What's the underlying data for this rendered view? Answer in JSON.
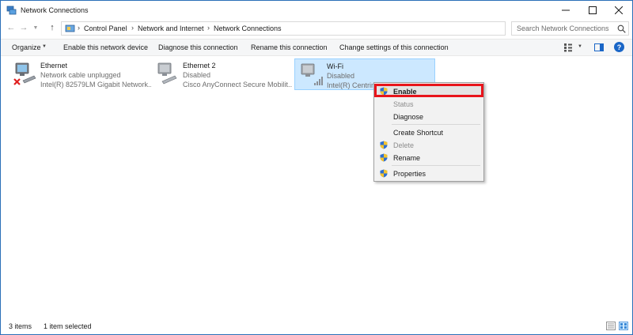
{
  "window": {
    "title": "Network Connections",
    "accent": "#2b6fb8"
  },
  "address": {
    "crumbs": [
      "Control Panel",
      "Network and Internet",
      "Network Connections"
    ]
  },
  "search": {
    "placeholder": "Search Network Connections"
  },
  "commands": {
    "organize": "Organize",
    "enable": "Enable this network device",
    "diagnose": "Diagnose this connection",
    "rename": "Rename this connection",
    "change": "Change settings of this connection"
  },
  "connections": [
    {
      "name": "Ethernet",
      "status": "Network cable unplugged",
      "device": "Intel(R) 82579LM Gigabit Network...",
      "icon": "ethernet-error-icon"
    },
    {
      "name": "Ethernet 2",
      "status": "Disabled",
      "device": "Cisco AnyConnect Secure Mobilit...",
      "icon": "ethernet-disabled-icon"
    },
    {
      "name": "Wi-Fi",
      "status": "Disabled",
      "device": "Intel(R) Centrino(R) Advanced-N...",
      "icon": "wifi-disabled-icon"
    }
  ],
  "context_menu": {
    "items": [
      {
        "label": "Enable",
        "shield": true,
        "bold": true,
        "disabled": false
      },
      {
        "label": "Status",
        "shield": false,
        "bold": false,
        "disabled": true
      },
      {
        "label": "Diagnose",
        "shield": false,
        "bold": false,
        "disabled": false
      },
      {
        "label": "Create Shortcut",
        "shield": false,
        "bold": false,
        "disabled": false
      },
      {
        "label": "Delete",
        "shield": true,
        "bold": false,
        "disabled": true
      },
      {
        "label": "Rename",
        "shield": true,
        "bold": false,
        "disabled": false
      },
      {
        "label": "Properties",
        "shield": true,
        "bold": false,
        "disabled": false
      }
    ],
    "highlight_color": "#e8141b"
  },
  "status": {
    "count": "3 items",
    "selected": "1 item selected"
  },
  "colors": {
    "selection": "#cce8ff",
    "help": "#1a66c7"
  }
}
